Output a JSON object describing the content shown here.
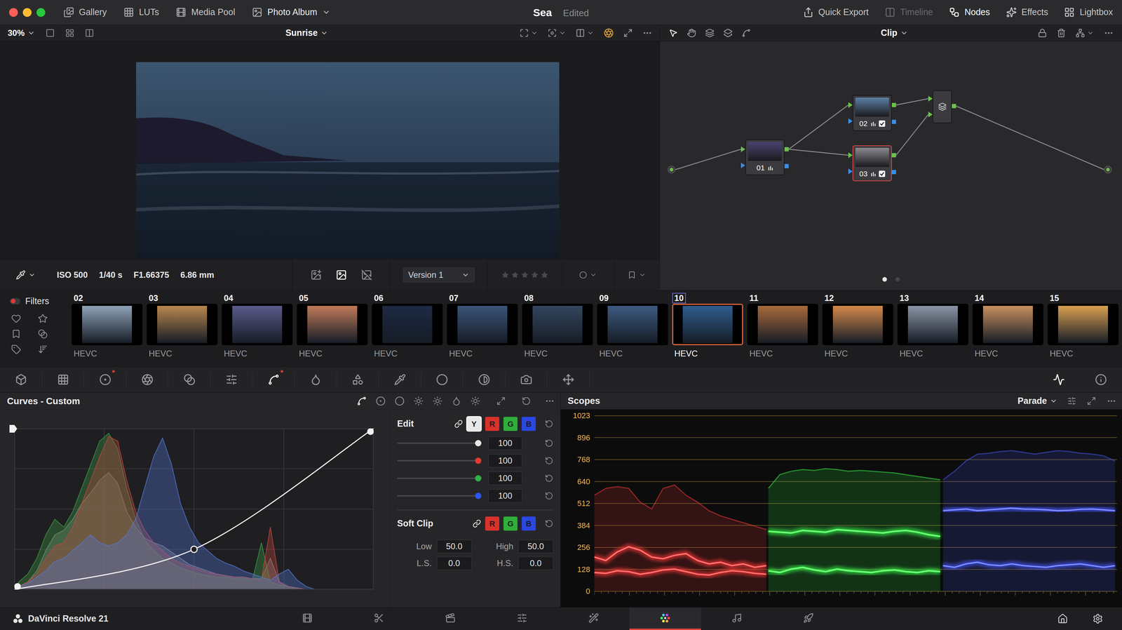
{
  "window": {
    "title": "Sea",
    "status": "Edited",
    "traffic_lights": [
      {
        "color": "#ff5f57"
      },
      {
        "color": "#febc2e"
      },
      {
        "color": "#28c840"
      }
    ]
  },
  "top_nav_left": [
    {
      "label": "Gallery",
      "dropdown": false
    },
    {
      "label": "LUTs",
      "dropdown": false
    },
    {
      "label": "Media Pool",
      "dropdown": false
    },
    {
      "label": "Photo Album",
      "dropdown": true
    }
  ],
  "top_nav_right": [
    {
      "label": "Quick Export",
      "disabled": false,
      "selected": false
    },
    {
      "label": "Timeline",
      "disabled": true,
      "selected": false
    },
    {
      "label": "Nodes",
      "disabled": false,
      "selected": true
    },
    {
      "label": "Effects",
      "disabled": false,
      "selected": false
    },
    {
      "label": "Lightbox",
      "disabled": false,
      "selected": false
    }
  ],
  "viewer_toolbar": {
    "zoom": "30%",
    "clip_name": "Sunrise"
  },
  "node_toolbar": {
    "mode": "Clip"
  },
  "nodes": [
    {
      "label": "01",
      "selected": false,
      "color": "#4a4270",
      "checked": null
    },
    {
      "label": "02",
      "selected": false,
      "color": "#5b7fa6",
      "checked": true
    },
    {
      "label": "03",
      "selected": true,
      "color": "#8a8a8e",
      "checked": true
    }
  ],
  "node_pages": [
    {
      "selected": true
    },
    {
      "selected": false
    }
  ],
  "clip_info": {
    "iso": "ISO 500",
    "shutter": "1/40 s",
    "aperture": "F1.66375",
    "focal_length": "6.86 mm"
  },
  "view_modes": [
    {
      "selected": false
    },
    {
      "selected": true
    },
    {
      "selected": false
    }
  ],
  "version": "Version 1",
  "rating": {
    "stars": 0,
    "max": 5
  },
  "filters": {
    "label": "Filters",
    "on": true
  },
  "thumbnails": [
    {
      "number": "02",
      "codec": "HEVC",
      "selected": false,
      "color": "#8fa3b8"
    },
    {
      "number": "03",
      "codec": "HEVC",
      "selected": false,
      "color": "#b9874e"
    },
    {
      "number": "04",
      "codec": "HEVC",
      "selected": false,
      "color": "#5a5a8a"
    },
    {
      "number": "05",
      "codec": "HEVC",
      "selected": false,
      "color": "#c07a5a"
    },
    {
      "number": "06",
      "codec": "HEVC",
      "selected": false,
      "color": "#1e2a44"
    },
    {
      "number": "07",
      "codec": "HEVC",
      "selected": false,
      "color": "#3a5478"
    },
    {
      "number": "08",
      "codec": "HEVC",
      "selected": false,
      "color": "#33465e"
    },
    {
      "number": "09",
      "codec": "HEVC",
      "selected": false,
      "color": "#3d5a80"
    },
    {
      "number": "10",
      "codec": "HEVC",
      "selected": true,
      "color": "#2f5d8f"
    },
    {
      "number": "11",
      "codec": "HEVC",
      "selected": false,
      "color": "#a86a3a"
    },
    {
      "number": "12",
      "codec": "HEVC",
      "selected": false,
      "color": "#d4894a"
    },
    {
      "number": "13",
      "codec": "HEVC",
      "selected": false,
      "color": "#8a94a4"
    },
    {
      "number": "14",
      "codec": "HEVC",
      "selected": false,
      "color": "#c89060"
    },
    {
      "number": "15",
      "codec": "HEVC",
      "selected": false,
      "color": "#d9a050"
    }
  ],
  "palette_tools": [
    {
      "modified": false,
      "selected": false
    },
    {
      "modified": false,
      "selected": false
    },
    {
      "modified": true,
      "selected": false
    },
    {
      "modified": false,
      "selected": false
    },
    {
      "modified": false,
      "selected": false
    },
    {
      "modified": false,
      "selected": false
    },
    {
      "modified": true,
      "selected": true
    },
    {
      "modified": false,
      "selected": false
    },
    {
      "modified": false,
      "selected": false
    },
    {
      "modified": false,
      "selected": false
    },
    {
      "modified": false,
      "selected": false
    },
    {
      "modified": false,
      "selected": false
    },
    {
      "modified": false,
      "selected": false
    },
    {
      "modified": false,
      "selected": false
    }
  ],
  "right_tools": [
    {
      "selected": true
    },
    {
      "selected": false
    }
  ],
  "curves": {
    "title": "Curves - Custom",
    "modes": [
      {
        "selected": true
      },
      {
        "selected": false
      },
      {
        "selected": false
      },
      {
        "selected": false
      },
      {
        "selected": false
      },
      {
        "selected": false
      },
      {
        "selected": false
      }
    ],
    "points": [
      [
        0,
        0
      ],
      [
        0.5,
        0.25
      ],
      [
        1,
        1
      ]
    ],
    "histogram": [
      {
        "color": "#8c8c8c",
        "values": [
          0.02,
          0.05,
          0.12,
          0.25,
          0.35,
          0.38,
          0.45,
          0.55,
          0.62,
          0.7,
          0.75,
          0.68,
          0.5,
          0.4,
          0.33,
          0.3,
          0.28,
          0.24,
          0.2,
          0.16,
          0.14,
          0.12,
          0.1,
          0.09,
          0.08,
          0.08,
          0.07,
          0.07,
          0.2,
          0.05,
          0.02,
          0.01,
          0,
          0,
          0,
          0,
          0,
          0,
          0,
          0
        ]
      },
      {
        "color": "#3f9a45",
        "values": [
          0.05,
          0.1,
          0.2,
          0.35,
          0.45,
          0.4,
          0.5,
          0.65,
          0.8,
          0.95,
          1.0,
          0.9,
          0.65,
          0.45,
          0.32,
          0.25,
          0.2,
          0.17,
          0.14,
          0.12,
          0.1,
          0.09,
          0.08,
          0.08,
          0.07,
          0.07,
          0.06,
          0.3,
          0.05,
          0.03,
          0.02,
          0.01,
          0,
          0,
          0,
          0,
          0,
          0,
          0,
          0
        ]
      },
      {
        "color": "#c0473f",
        "values": [
          0.02,
          0.05,
          0.1,
          0.2,
          0.28,
          0.3,
          0.4,
          0.55,
          0.7,
          0.85,
          0.98,
          0.95,
          0.7,
          0.5,
          0.38,
          0.3,
          0.25,
          0.2,
          0.17,
          0.15,
          0.13,
          0.11,
          0.1,
          0.09,
          0.08,
          0.08,
          0.07,
          0.06,
          0.4,
          0.05,
          0.02,
          0.01,
          0,
          0,
          0,
          0,
          0,
          0,
          0,
          0
        ]
      },
      {
        "color": "#5578d6",
        "values": [
          0.02,
          0.04,
          0.08,
          0.12,
          0.18,
          0.2,
          0.25,
          0.3,
          0.35,
          0.3,
          0.28,
          0.3,
          0.35,
          0.45,
          0.65,
          0.85,
          0.97,
          0.8,
          0.55,
          0.4,
          0.3,
          0.25,
          0.2,
          0.17,
          0.15,
          0.12,
          0.1,
          0.08,
          0.06,
          0.1,
          0.13,
          0.06,
          0.02,
          0,
          0,
          0,
          0,
          0,
          0,
          0
        ]
      }
    ]
  },
  "edit": {
    "label": "Edit",
    "linked": true,
    "channels": [
      {
        "label": "Y",
        "selected": true,
        "color": "#e8e8e8"
      },
      {
        "label": "R",
        "selected": false,
        "color": "#d8322b"
      },
      {
        "label": "G",
        "selected": false,
        "color": "#2fae3a"
      },
      {
        "label": "B",
        "selected": false,
        "color": "#2a47e0"
      }
    ],
    "sliders": [
      {
        "value": "100",
        "level": 1,
        "color": "#e6e6e6"
      },
      {
        "value": "100",
        "level": 1,
        "color": "#e03a32"
      },
      {
        "value": "100",
        "level": 1,
        "color": "#33b043"
      },
      {
        "value": "100",
        "level": 1,
        "color": "#2d55f0"
      }
    ]
  },
  "soft_clip": {
    "label": "Soft Clip",
    "linked": true,
    "channels": [
      {
        "label": "R",
        "color": "#d8322b"
      },
      {
        "label": "G",
        "color": "#2fae3a"
      },
      {
        "label": "B",
        "color": "#2a47e0"
      }
    ],
    "fields": [
      {
        "label": "Low",
        "value": "50.0"
      },
      {
        "label": "High",
        "value": "50.0"
      },
      {
        "label": "L.S.",
        "value": "0.0"
      },
      {
        "label": "H.S.",
        "value": "0.0"
      }
    ]
  },
  "scopes": {
    "title": "Scopes",
    "mode": "Parade",
    "ticks": [
      "1023",
      "896",
      "768",
      "640",
      "512",
      "384",
      "256",
      "128",
      "0"
    ],
    "channels": [
      {
        "color": "#ff3b3b",
        "upper": [
          560,
          600,
          610,
          600,
          520,
          480,
          600,
          620,
          560,
          520,
          470,
          440,
          420,
          400,
          380,
          360
        ],
        "bands": [
          [
            110,
            105,
            120,
            115,
            100,
            110,
            125,
            130,
            115,
            100,
            95,
            110,
            120,
            115,
            105,
            100
          ],
          [
            200,
            180,
            230,
            260,
            240,
            200,
            190,
            210,
            220,
            180,
            160,
            170,
            150,
            160,
            140,
            150
          ]
        ]
      },
      {
        "color": "#3bff4a",
        "upper": [
          600,
          680,
          700,
          710,
          705,
          715,
          710,
          700,
          705,
          700,
          695,
          690,
          680,
          670,
          660,
          650
        ],
        "bands": [
          [
            350,
            345,
            340,
            355,
            350,
            345,
            360,
            355,
            350,
            345,
            340,
            350,
            355,
            345,
            330,
            320
          ],
          [
            120,
            110,
            130,
            140,
            125,
            115,
            130,
            120,
            115,
            110,
            120,
            125,
            115,
            110,
            120,
            115
          ]
        ]
      },
      {
        "color": "#4a5cff",
        "upper": [
          650,
          700,
          760,
          800,
          805,
          815,
          820,
          810,
          800,
          810,
          820,
          815,
          805,
          800,
          790,
          760
        ],
        "bands": [
          [
            470,
            475,
            480,
            470,
            475,
            480,
            485,
            480,
            478,
            475,
            470,
            472,
            478,
            480,
            475,
            470
          ],
          [
            150,
            140,
            160,
            170,
            155,
            150,
            160,
            150,
            145,
            140,
            150,
            155,
            160,
            150,
            140,
            150
          ]
        ]
      }
    ]
  },
  "app": {
    "name": "DaVinci Resolve 21"
  },
  "pages": [
    {
      "selected": false
    },
    {
      "selected": false
    },
    {
      "selected": false
    },
    {
      "selected": false
    },
    {
      "selected": false
    },
    {
      "selected": true
    },
    {
      "selected": false
    },
    {
      "selected": false
    }
  ]
}
